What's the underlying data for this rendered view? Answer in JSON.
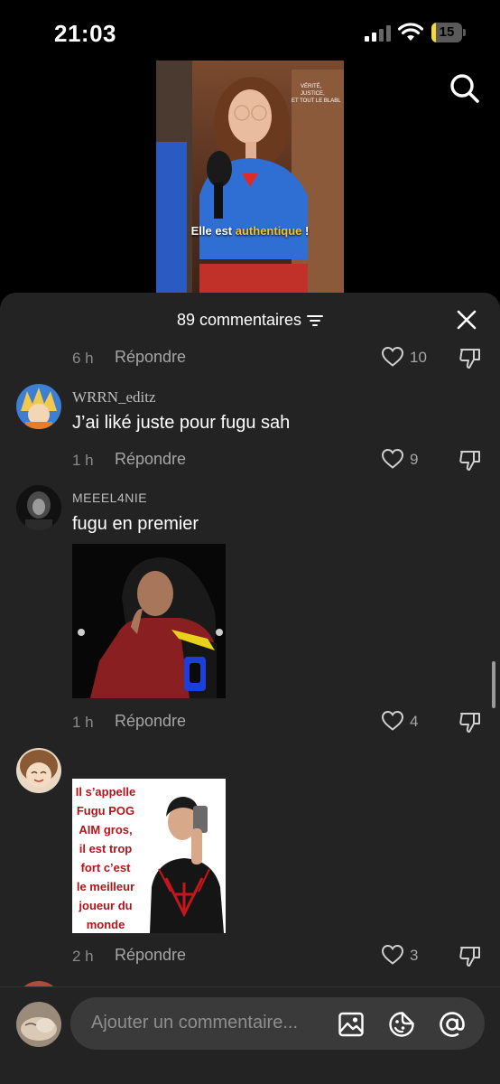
{
  "status_bar": {
    "time": "21:03",
    "battery_level": "15"
  },
  "video": {
    "caption_prefix": "Elle est ",
    "caption_highlight": "authentique",
    "caption_suffix": " !"
  },
  "sheet": {
    "title": "89 commentaires"
  },
  "comments": [
    {
      "time": "6 h",
      "reply": "Répondre",
      "likes": "10"
    },
    {
      "user": "WRRN_editz",
      "text": "J’ai liké juste pour fugu sah",
      "time": "1 h",
      "reply": "Répondre",
      "likes": "9"
    },
    {
      "user": "MEEEL4NIE",
      "text": "fugu en premier",
      "time": "1 h",
      "reply": "Répondre",
      "likes": "4"
    },
    {
      "user": "",
      "meme_lines": [
        "Il s’appelle",
        "Fugu POG",
        "AIM gros,",
        "il est trop",
        "fort c’est",
        "le meilleur",
        "joueur du",
        "monde"
      ],
      "time": "2 h",
      "reply": "Répondre",
      "likes": "3"
    }
  ],
  "input": {
    "placeholder": "Ajouter un commentaire..."
  },
  "colors": {
    "sheet_bg": "#232323",
    "highlight": "#f6c419",
    "input_bg": "#3a3a3a"
  },
  "icons": [
    "search-icon",
    "filter-icon",
    "close-icon",
    "heart-icon",
    "dislike-icon",
    "image-icon",
    "sticker-icon",
    "mention-icon"
  ]
}
